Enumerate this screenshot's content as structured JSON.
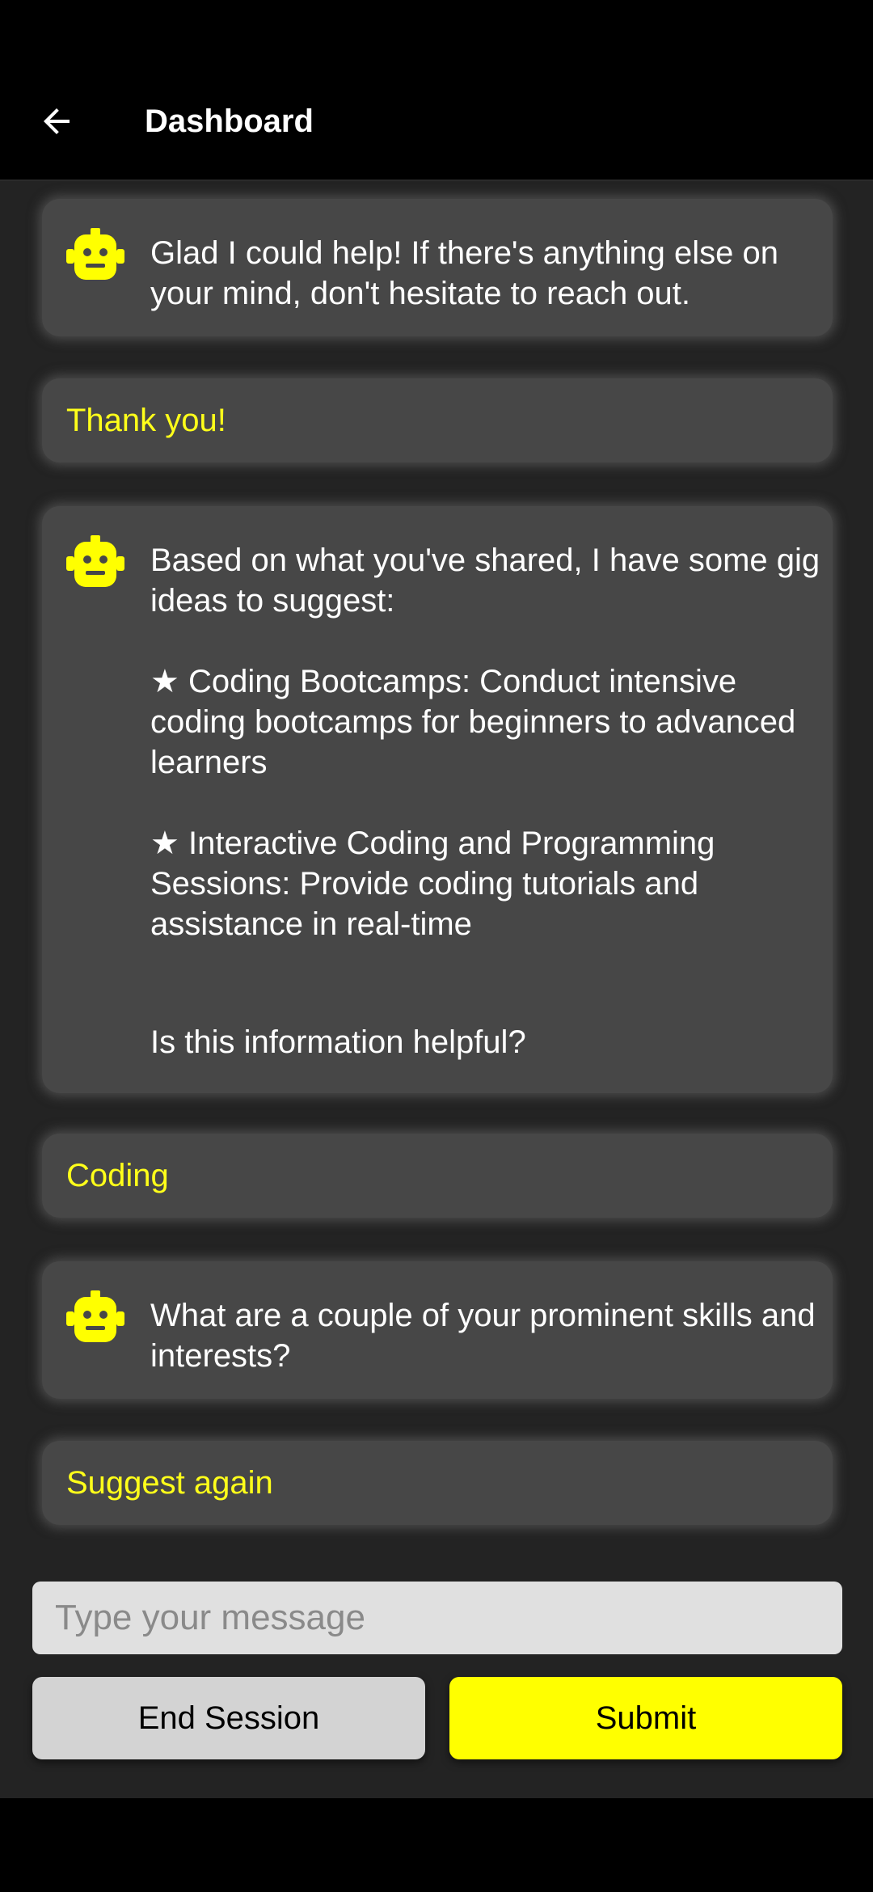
{
  "app_bar": {
    "title": "Dashboard",
    "back_icon": "arrow-left-icon"
  },
  "messages": [
    {
      "type": "bot",
      "icon": "robot-icon",
      "paragraphs": [
        "Glad I could help! If there's anything else on your mind, don't hesitate to reach out."
      ]
    },
    {
      "type": "user",
      "text": "Thank you!"
    },
    {
      "type": "bot",
      "icon": "robot-icon",
      "paragraphs": [
        "Based on what you've shared, I have some gig ideas to suggest:",
        "★ Coding Bootcamps: Conduct intensive coding bootcamps for beginners to advanced learners",
        "★ Interactive Coding and Programming Sessions: Provide coding tutorials and assistance in real-time",
        "Is this information helpful?"
      ]
    },
    {
      "type": "user",
      "text": "Coding"
    },
    {
      "type": "bot",
      "icon": "robot-icon",
      "paragraphs": [
        "What are a couple of your prominent skills and interests?"
      ]
    },
    {
      "type": "user",
      "text": "Suggest again"
    }
  ],
  "composer": {
    "placeholder": "Type your message",
    "value": "",
    "end_session_label": "End Session",
    "submit_label": "Submit"
  },
  "colors": {
    "accent": "#ffff00",
    "user_text": "#ffff1a",
    "bubble_bg": "#474747",
    "background": "#232323"
  }
}
